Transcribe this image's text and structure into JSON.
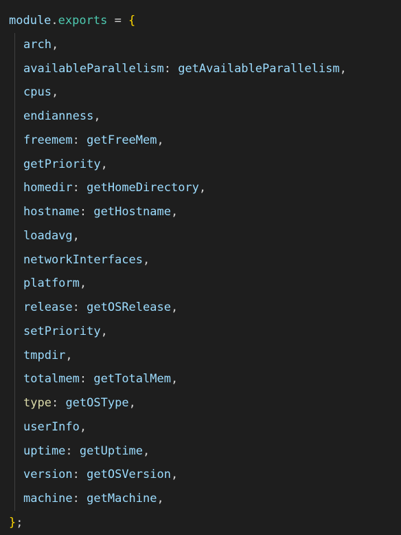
{
  "code": {
    "header": {
      "object": "module",
      "dot": ".",
      "property": "exports",
      "assign": " = ",
      "open_brace": "{"
    },
    "entries": [
      {
        "key": "arch",
        "value": ""
      },
      {
        "key": "availableParallelism",
        "value": "getAvailableParallelism"
      },
      {
        "key": "cpus",
        "value": ""
      },
      {
        "key": "endianness",
        "value": ""
      },
      {
        "key": "freemem",
        "value": "getFreeMem"
      },
      {
        "key": "getPriority",
        "value": ""
      },
      {
        "key": "homedir",
        "value": "getHomeDirectory"
      },
      {
        "key": "hostname",
        "value": "getHostname"
      },
      {
        "key": "loadavg",
        "value": ""
      },
      {
        "key": "networkInterfaces",
        "value": ""
      },
      {
        "key": "platform",
        "value": ""
      },
      {
        "key": "release",
        "value": "getOSRelease"
      },
      {
        "key": "setPriority",
        "value": ""
      },
      {
        "key": "tmpdir",
        "value": ""
      },
      {
        "key": "totalmem",
        "value": "getTotalMem"
      },
      {
        "key": "type",
        "value": "getOSType"
      },
      {
        "key": "userInfo",
        "value": ""
      },
      {
        "key": "uptime",
        "value": "getUptime"
      },
      {
        "key": "version",
        "value": "getOSVersion"
      },
      {
        "key": "machine",
        "value": "getMachine"
      }
    ],
    "footer": {
      "close_brace": "}",
      "semicolon": ";"
    },
    "separator": ": ",
    "comma": ","
  },
  "colors": {
    "background": "#1e1e1e",
    "variable": "#9cdcfe",
    "property": "#4ec9b0",
    "function": "#dcdcaa",
    "brace": "#ffd700",
    "punctuation": "#d4d4d4"
  }
}
